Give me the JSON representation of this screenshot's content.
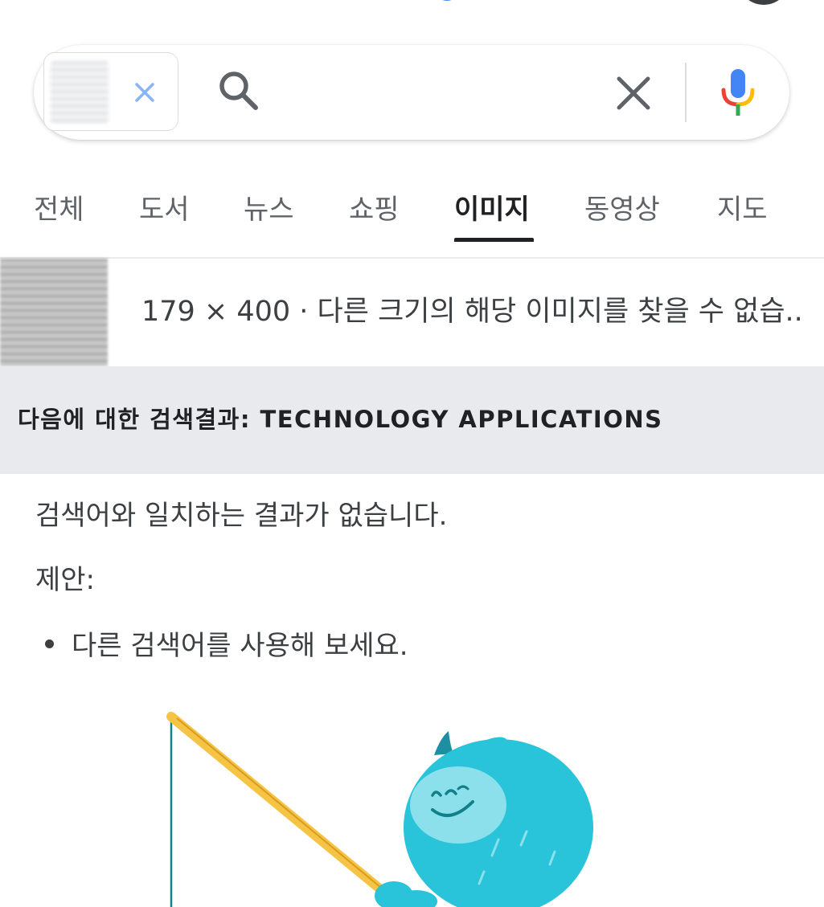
{
  "search": {
    "query_value": "",
    "query_chip": "image-query-chip"
  },
  "icons": {
    "chip_close": "close-icon",
    "search": "search-icon",
    "clear": "close-icon",
    "mic": "mic-icon"
  },
  "tabs": [
    {
      "label": "전체",
      "active": false
    },
    {
      "label": "도서",
      "active": false
    },
    {
      "label": "뉴스",
      "active": false
    },
    {
      "label": "쇼핑",
      "active": false
    },
    {
      "label": "이미지",
      "active": true
    },
    {
      "label": "동영상",
      "active": false
    },
    {
      "label": "지도",
      "active": false
    }
  ],
  "image_info": {
    "text": "179 × 400 · 다른 크기의 해당 이미지를 찾을 수 없습..."
  },
  "result_header": {
    "text": "다음에 대한 검색결과: TECHNOLOGY APPLICATIONS"
  },
  "body": {
    "no_result": "검색어와 일치하는 결과가 없습니다.",
    "suggestion_label": "제안:",
    "suggestions": [
      "다른 검색어를 사용해 보세요."
    ]
  },
  "colors": {
    "active_tab": "#202124",
    "inactive_tab": "#5f6368",
    "header_band": "#e8eaed",
    "monster": "#29c4d9",
    "rod": "#f6c445"
  }
}
